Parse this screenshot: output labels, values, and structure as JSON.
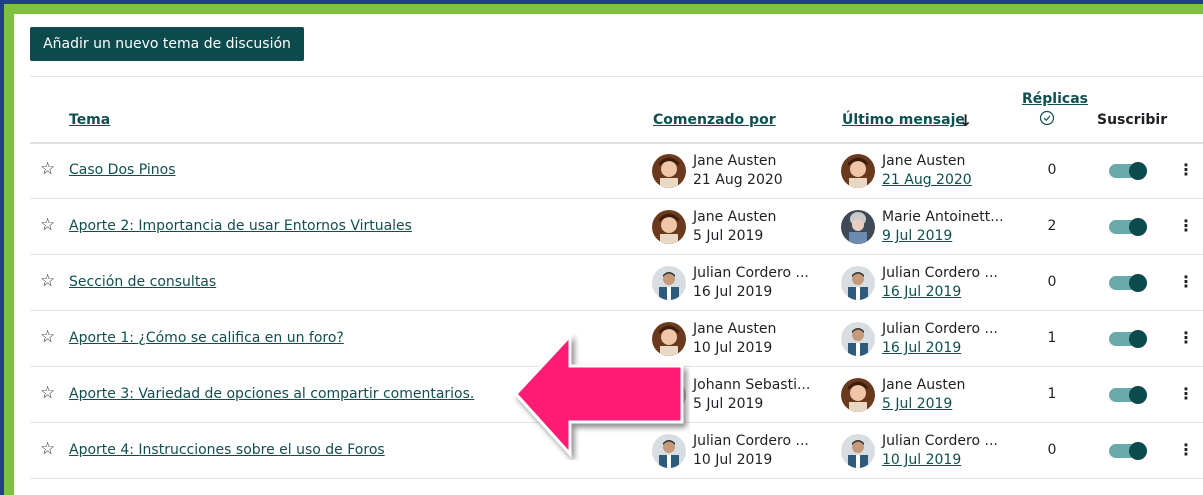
{
  "add_button": "Añadir un nuevo tema de discusión",
  "headers": {
    "topic": "Tema",
    "started_by": "Comenzado por",
    "last_post": "Último mensaje",
    "replies": "Réplicas",
    "subscribe": "Suscribir"
  },
  "colors": {
    "accent": "#0f4f50",
    "toggle_knob": "#0c4a4e",
    "arrow": "#ff1a75"
  },
  "rows": [
    {
      "topic": "Caso Dos Pinos",
      "starter": "Jane Austen",
      "start_date": "21 Aug 2020",
      "last_user": "Jane Austen",
      "last_date": "21 Aug 2020",
      "replies": "0"
    },
    {
      "topic": "Aporte 2: Importancia de usar Entornos Virtuales",
      "starter": "Jane Austen",
      "start_date": "5 Jul 2019",
      "last_user": "Marie Antoinett...",
      "last_date": "9 Jul 2019",
      "replies": "2"
    },
    {
      "topic": "Sección de consultas",
      "starter": "Julian Cordero ...",
      "start_date": "16 Jul 2019",
      "last_user": "Julian Cordero ...",
      "last_date": "16 Jul 2019",
      "replies": "0"
    },
    {
      "topic": "Aporte 1: ¿Cómo se califica en un foro?",
      "starter": "Jane Austen",
      "start_date": "10 Jul 2019",
      "last_user": "Julian Cordero ...",
      "last_date": "16 Jul 2019",
      "replies": "1"
    },
    {
      "topic": "Aporte 3: Variedad de opciones al compartir comentarios.",
      "starter": "Johann Sebasti...",
      "start_date": "5 Jul 2019",
      "last_user": "Jane Austen",
      "last_date": "5 Jul 2019",
      "replies": "1"
    },
    {
      "topic": "Aporte 4: Instrucciones sobre el uso de Foros",
      "starter": "Julian Cordero ...",
      "start_date": "10 Jul 2019",
      "last_user": "Julian Cordero ...",
      "last_date": "10 Jul 2019",
      "replies": "0"
    }
  ]
}
